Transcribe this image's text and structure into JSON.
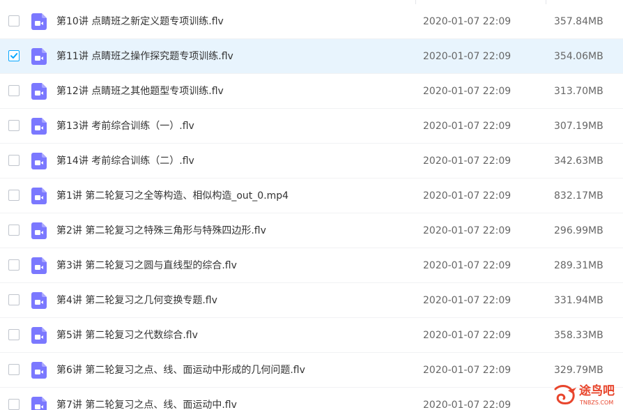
{
  "colors": {
    "accent": "#06a7ff",
    "icon": "#7b78ff",
    "selected_row": "#e8f4fd",
    "watermark": "#e8452c"
  },
  "files": [
    {
      "name": "第10讲 点睛班之新定义题专项训练.flv",
      "date": "2020-01-07 22:09",
      "size": "357.84MB",
      "selected": false,
      "icon": "video-file-icon"
    },
    {
      "name": "第11讲 点睛班之操作探究题专项训练.flv",
      "date": "2020-01-07 22:09",
      "size": "354.06MB",
      "selected": true,
      "icon": "video-file-icon"
    },
    {
      "name": "第12讲 点睛班之其他题型专项训练.flv",
      "date": "2020-01-07 22:09",
      "size": "313.70MB",
      "selected": false,
      "icon": "video-file-icon"
    },
    {
      "name": "第13讲 考前综合训练（一）.flv",
      "date": "2020-01-07 22:09",
      "size": "307.19MB",
      "selected": false,
      "icon": "video-file-icon"
    },
    {
      "name": "第14讲 考前综合训练（二）.flv",
      "date": "2020-01-07 22:09",
      "size": "342.63MB",
      "selected": false,
      "icon": "video-file-icon"
    },
    {
      "name": "第1讲 第二轮复习之全等构造、相似构造_out_0.mp4",
      "date": "2020-01-07 22:09",
      "size": "832.17MB",
      "selected": false,
      "icon": "video-file-icon"
    },
    {
      "name": "第2讲 第二轮复习之特殊三角形与特殊四边形.flv",
      "date": "2020-01-07 22:09",
      "size": "296.99MB",
      "selected": false,
      "icon": "video-file-icon"
    },
    {
      "name": "第3讲 第二轮复习之圆与直线型的综合.flv",
      "date": "2020-01-07 22:09",
      "size": "289.31MB",
      "selected": false,
      "icon": "video-file-icon"
    },
    {
      "name": "第4讲 第二轮复习之几何变换专题.flv",
      "date": "2020-01-07 22:09",
      "size": "331.94MB",
      "selected": false,
      "icon": "video-file-icon"
    },
    {
      "name": "第5讲 第二轮复习之代数综合.flv",
      "date": "2020-01-07 22:09",
      "size": "358.33MB",
      "selected": false,
      "icon": "video-file-icon"
    },
    {
      "name": "第6讲 第二轮复习之点、线、面运动中形成的几何问题.flv",
      "date": "2020-01-07 22:09",
      "size": "329.79MB",
      "selected": false,
      "icon": "video-file-icon"
    },
    {
      "name": "第7讲 第二轮复习之点、线、面运动中.flv",
      "date": "2020-01-07 22:09",
      "size": "",
      "selected": false,
      "icon": "video-file-icon"
    }
  ],
  "watermark": {
    "text": "途鸟吧",
    "subtext": "TNBZS.COM"
  }
}
